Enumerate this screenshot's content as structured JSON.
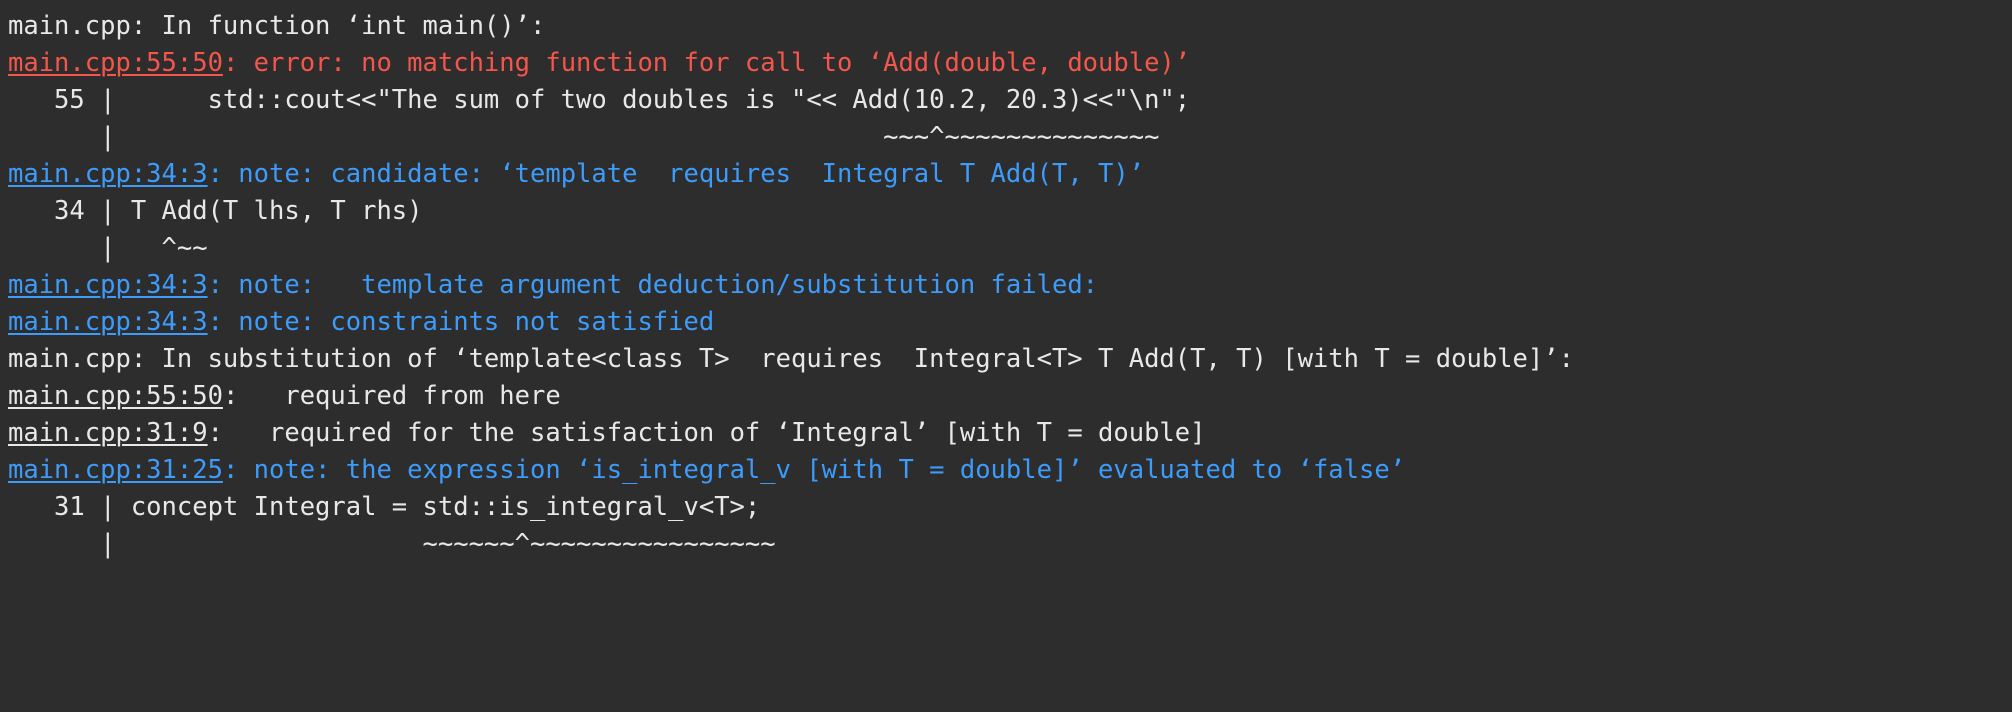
{
  "terminal": {
    "background_color": "#2d2d2d",
    "foreground_color": "#e8e8e8",
    "error_color": "#f4564b",
    "note_color": "#3d9bfa",
    "title": "gcc compiler diagnostic output"
  },
  "lines": [
    {
      "id": "line-01-context",
      "kind": "context",
      "segments": [
        {
          "text": "main.cpp: In function ‘int main()’:",
          "color": "white",
          "underline": false
        }
      ]
    },
    {
      "id": "line-02-error",
      "kind": "error",
      "segments": [
        {
          "text": "main.cpp:55:50",
          "color": "red",
          "underline": true
        },
        {
          "text": ": error: no matching function for call to ‘Add(double, double)’",
          "color": "red",
          "underline": false
        }
      ]
    },
    {
      "id": "line-03-source-55",
      "kind": "source",
      "segments": [
        {
          "text": "   55 |      std::cout<<\"The sum of two doubles is \"<< Add(10.2, 20.3)<<\"\\n\";",
          "color": "white",
          "underline": false
        }
      ]
    },
    {
      "id": "line-04-marker",
      "kind": "marker",
      "segments": [
        {
          "text": "      |                                                  ~~~^~~~~~~~~~~~~~~",
          "color": "white",
          "underline": false
        }
      ]
    },
    {
      "id": "line-05-note-candidate",
      "kind": "note",
      "segments": [
        {
          "text": "main.cpp:34:3",
          "color": "blue",
          "underline": true
        },
        {
          "text": ": note: candidate: ‘template  requires  Integral T Add(T, T)’",
          "color": "blue",
          "underline": false
        }
      ]
    },
    {
      "id": "line-06-source-34",
      "kind": "source",
      "segments": [
        {
          "text": "   34 | T Add(T lhs, T rhs)",
          "color": "white",
          "underline": false
        }
      ]
    },
    {
      "id": "line-07-marker",
      "kind": "marker",
      "segments": [
        {
          "text": "      |   ^~~",
          "color": "white",
          "underline": false
        }
      ]
    },
    {
      "id": "line-08-note-deduction",
      "kind": "note",
      "segments": [
        {
          "text": "main.cpp:34:3",
          "color": "blue",
          "underline": true
        },
        {
          "text": ": note:   template argument deduction/substitution failed:",
          "color": "blue",
          "underline": false
        }
      ]
    },
    {
      "id": "line-09-note-constraints",
      "kind": "note",
      "segments": [
        {
          "text": "main.cpp:34:3",
          "color": "blue",
          "underline": true
        },
        {
          "text": ": note: constraints not satisfied",
          "color": "blue",
          "underline": false
        }
      ]
    },
    {
      "id": "line-10-context-substitution",
      "kind": "context",
      "segments": [
        {
          "text": "main.cpp: In substitution of ‘template<class T>  requires  Integral<T> T Add(T, T) [with T = double]’:",
          "color": "white",
          "underline": false
        }
      ]
    },
    {
      "id": "line-11-required-from-here",
      "kind": "context",
      "segments": [
        {
          "text": "main.cpp:55:50",
          "color": "white",
          "underline": true
        },
        {
          "text": ":   required from here",
          "color": "white",
          "underline": false
        }
      ]
    },
    {
      "id": "line-12-required-satisfaction",
      "kind": "context",
      "segments": [
        {
          "text": "main.cpp:31:9",
          "color": "white",
          "underline": true
        },
        {
          "text": ":   required for the satisfaction of ‘Integral’ [with T = double]",
          "color": "white",
          "underline": false
        }
      ]
    },
    {
      "id": "line-13-note-expression",
      "kind": "note",
      "segments": [
        {
          "text": "main.cpp:31:25",
          "color": "blue",
          "underline": true
        },
        {
          "text": ": note: the expression ‘is_integral_v [with T = double]’ evaluated to ‘false’",
          "color": "blue",
          "underline": false
        }
      ]
    },
    {
      "id": "line-14-source-31",
      "kind": "source",
      "segments": [
        {
          "text": "   31 | concept Integral = std::is_integral_v<T>;",
          "color": "white",
          "underline": false
        }
      ]
    },
    {
      "id": "line-15-marker",
      "kind": "marker",
      "segments": [
        {
          "text": "      |                    ~~~~~~^~~~~~~~~~~~~~~~~",
          "color": "white",
          "underline": false
        }
      ]
    }
  ]
}
